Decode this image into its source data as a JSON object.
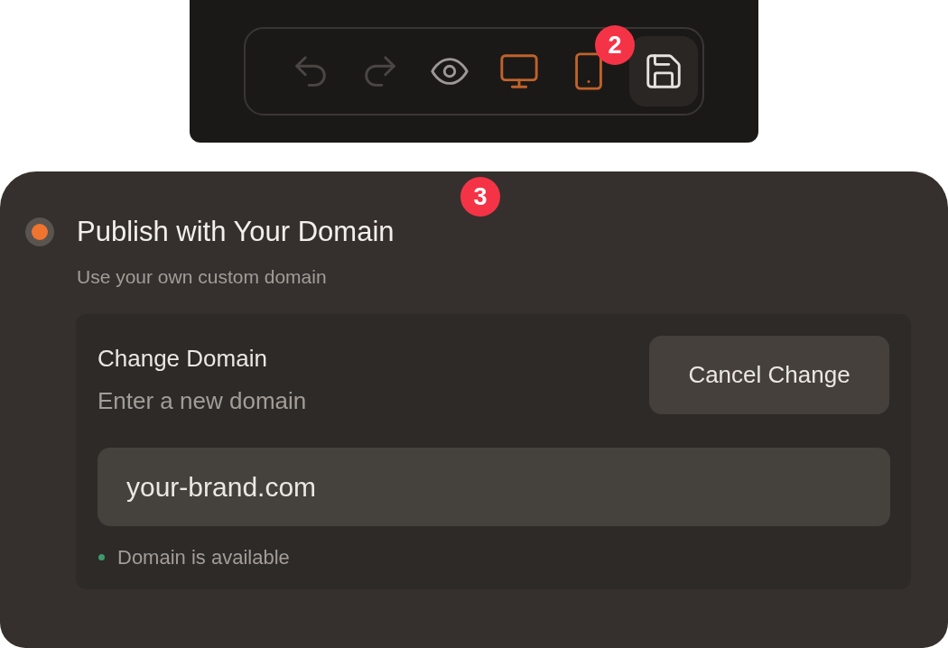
{
  "toolbar": {
    "tools": [
      {
        "kind": "undo",
        "disabled": true,
        "active": false,
        "selected": false
      },
      {
        "kind": "redo",
        "disabled": true,
        "active": false,
        "selected": false
      },
      {
        "kind": "preview",
        "disabled": false,
        "active": false,
        "selected": false
      },
      {
        "kind": "desktop",
        "disabled": false,
        "active": true,
        "selected": false
      },
      {
        "kind": "tablet",
        "disabled": false,
        "active": true,
        "selected": false
      },
      {
        "kind": "save",
        "disabled": false,
        "active": false,
        "selected": true
      }
    ],
    "badge": "2"
  },
  "publish_option": {
    "badge": "3",
    "selected": true,
    "title": "Publish with Your Domain",
    "subtitle": "Use your own custom domain",
    "change_domain": {
      "title": "Change Domain",
      "hint": "Enter a new domain",
      "cancel_button": "Cancel Change",
      "value": "your-brand.com",
      "status": {
        "text": "Domain is available",
        "color": "#3f9a6b"
      }
    }
  }
}
